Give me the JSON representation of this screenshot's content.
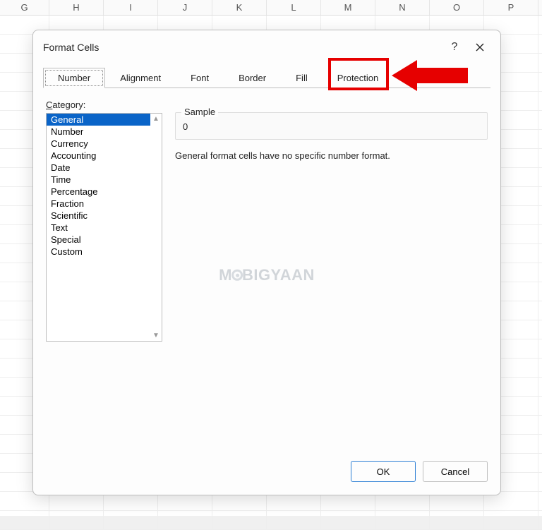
{
  "spreadsheet": {
    "columns": [
      "G",
      "H",
      "I",
      "J",
      "K",
      "L",
      "M",
      "N",
      "O",
      "P"
    ]
  },
  "dialog": {
    "title": "Format Cells",
    "help": "?",
    "tabs": [
      {
        "label": "Number",
        "active": true
      },
      {
        "label": "Alignment",
        "active": false
      },
      {
        "label": "Font",
        "active": false
      },
      {
        "label": "Border",
        "active": false
      },
      {
        "label": "Fill",
        "active": false
      },
      {
        "label": "Protection",
        "active": false
      }
    ],
    "category_label": "Category:",
    "categories": [
      "General",
      "Number",
      "Currency",
      "Accounting",
      "Date",
      "Time",
      "Percentage",
      "Fraction",
      "Scientific",
      "Text",
      "Special",
      "Custom"
    ],
    "selected_category_index": 0,
    "sample_label": "Sample",
    "sample_value": "0",
    "description": "General format cells have no specific number format.",
    "ok_label": "OK",
    "cancel_label": "Cancel"
  },
  "watermark": {
    "prefix": "M",
    "suffix": "BIGYAAN"
  },
  "annotation": {
    "highlight_tab_index": 5
  }
}
